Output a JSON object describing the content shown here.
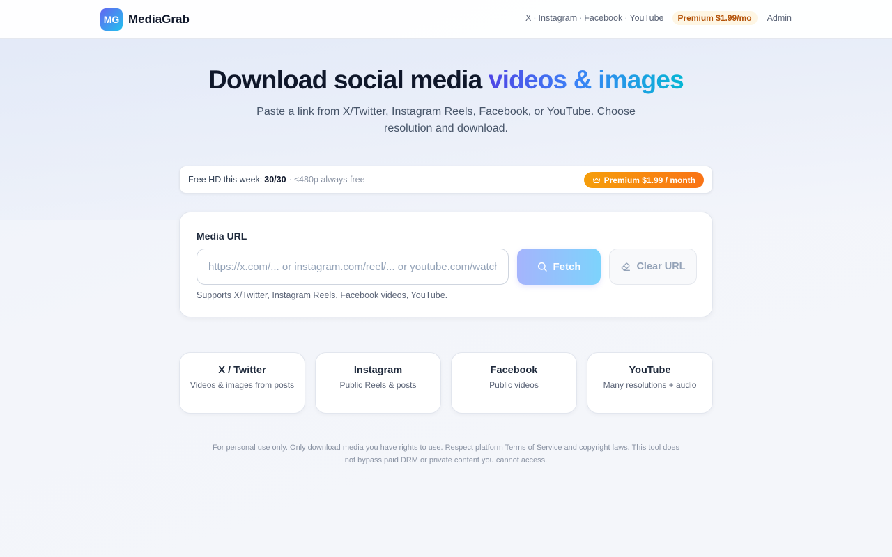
{
  "brand": {
    "logo_text": "MG",
    "name": "MediaGrab"
  },
  "nav": {
    "links": [
      "X",
      "Instagram",
      "Facebook",
      "YouTube"
    ],
    "premium_badge": "Premium $1.99/mo",
    "admin": "Admin"
  },
  "hero": {
    "title_plain": "Download social media ",
    "title_highlight": "videos & images",
    "subtitle": "Paste a link from X/Twitter, Instagram Reels, Facebook, or YouTube. Choose resolution and download."
  },
  "quota": {
    "label": "Free HD this week:",
    "value": "30/30",
    "note": "· ≤480p always free",
    "premium_button": "Premium $1.99 / month"
  },
  "form": {
    "label": "Media URL",
    "input_value": "",
    "input_placeholder": "https://x.com/... or instagram.com/reel/... or youtube.com/watch?v=...",
    "fetch_label": "Fetch",
    "clear_label": "Clear URL",
    "support_text": "Supports X/Twitter, Instagram Reels, Facebook videos, YouTube."
  },
  "platforms": [
    {
      "title": "X / Twitter",
      "desc": "Videos & images from posts"
    },
    {
      "title": "Instagram",
      "desc": "Public Reels & posts"
    },
    {
      "title": "Facebook",
      "desc": "Public videos"
    },
    {
      "title": "YouTube",
      "desc": "Many resolutions + audio"
    }
  ],
  "footer": {
    "disclaimer": "For personal use only. Only download media you have rights to use. Respect platform Terms of Service and copyright laws. This tool does not bypass paid DRM or private content you cannot access."
  },
  "icons": {
    "fetch": "search-icon",
    "clear": "eraser-icon",
    "premium": "crown-icon"
  },
  "colors": {
    "accent_start": "#4f46e5",
    "accent_end": "#06b6d4",
    "premium_start": "#f59e0b",
    "premium_end": "#f97316"
  }
}
